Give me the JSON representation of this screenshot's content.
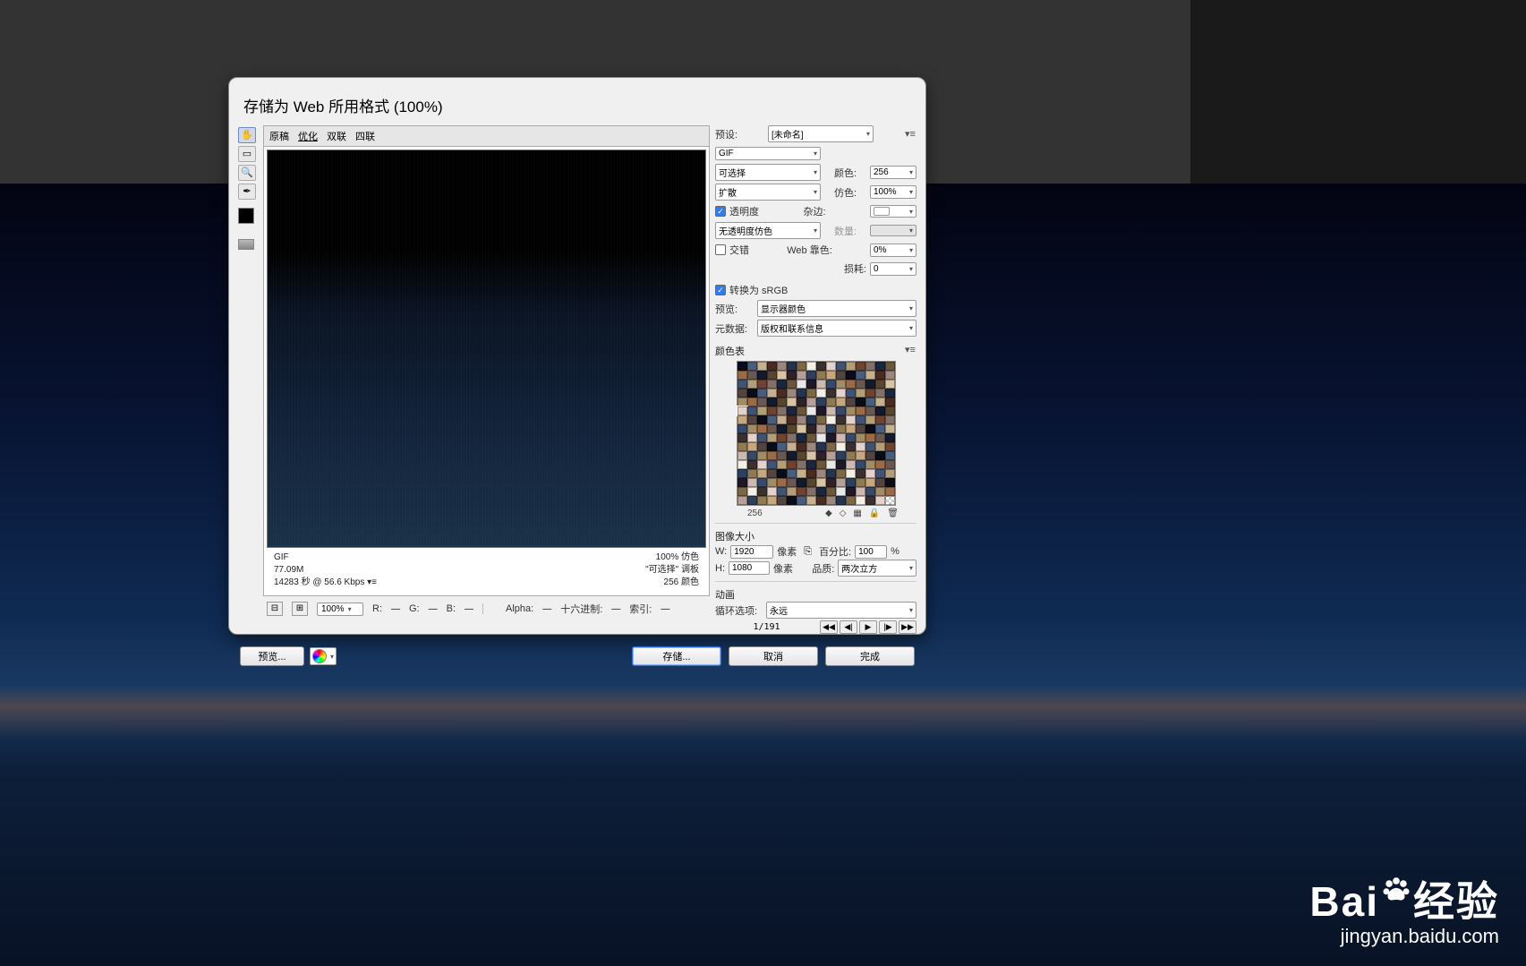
{
  "dialog": {
    "title": "存储为 Web 所用格式 (100%)",
    "tabs": {
      "original": "原稿",
      "optimized": "优化",
      "twoup": "双联",
      "fourup": "四联"
    },
    "info_left": {
      "format": "GIF",
      "size": "77.09M",
      "time": "14283 秒 @ 56.6 Kbps    ▾≡"
    },
    "info_right": {
      "zoom": "100% 仿色",
      "palette": "\"可选择\"  调板",
      "colors": "256 颜色"
    },
    "status": {
      "zoom": "100%",
      "r_lbl": "R:",
      "r_val": "—",
      "g_lbl": "G:",
      "g_val": "—",
      "b_lbl": "B:",
      "b_val": "—",
      "alpha_lbl": "Alpha:",
      "alpha_val": "—",
      "hex_lbl": "十六进制:",
      "hex_val": "—",
      "idx_lbl": "索引:",
      "idx_val": "—"
    },
    "footer": {
      "preview": "预览...",
      "save": "存储...",
      "cancel": "取消",
      "done": "完成"
    }
  },
  "settings": {
    "preset_lbl": "预设:",
    "preset_val": "[未命名]",
    "format_val": "GIF",
    "reduction_val": "可选择",
    "colors_lbl": "颜色:",
    "colors_val": "256",
    "dither_method": "扩散",
    "dither_lbl": "仿色:",
    "dither_val": "100%",
    "transparency_lbl": "透明度",
    "matte_lbl": "杂边:",
    "trans_dither_val": "无透明度仿色",
    "amount_lbl": "数量:",
    "interlaced_lbl": "交错",
    "websnap_lbl": "Web 靠色:",
    "websnap_val": "0%",
    "lossy_lbl": "损耗:",
    "lossy_val": "0",
    "srgb_lbl": "转换为 sRGB",
    "preview_lbl": "预览:",
    "preview_val": "显示器颜色",
    "metadata_lbl": "元数据:",
    "metadata_val": "版权和联系信息",
    "colortable_lbl": "颜色表",
    "colortable_count": "256",
    "imagesize_lbl": "图像大小",
    "w_lbl": "W:",
    "w_val": "1920",
    "h_lbl": "H:",
    "h_val": "1080",
    "px": "像素",
    "percent_lbl": "百分比:",
    "percent_val": "100",
    "percent_unit": "%",
    "quality_lbl": "品质:",
    "quality_val": "两次立方",
    "anim_lbl": "动画",
    "loop_lbl": "循环选项:",
    "loop_val": "永远",
    "frame": "1/191"
  },
  "watermark": {
    "brand": "Bai",
    "brand2": "经验",
    "url": "jingyan.baidu.com"
  }
}
